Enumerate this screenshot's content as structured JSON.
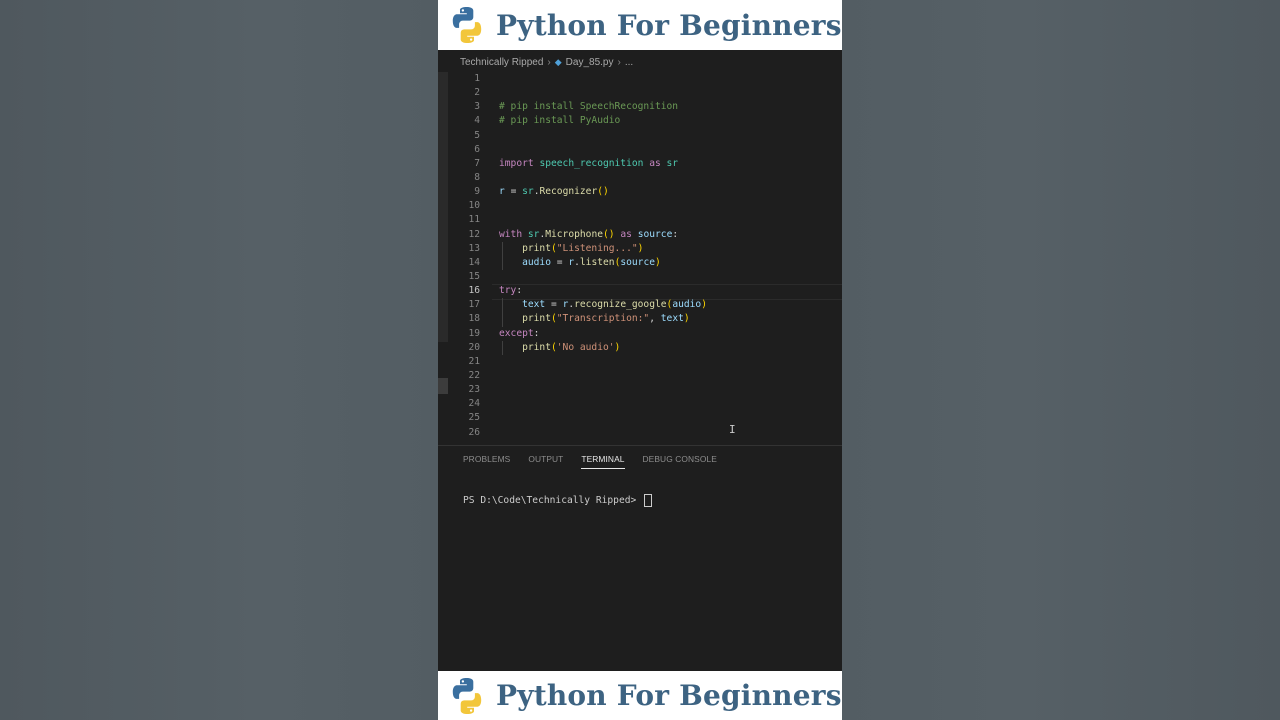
{
  "banner": {
    "title": "Python For Beginners"
  },
  "breadcrumb": {
    "folder": "Technically Ripped",
    "file": "Day_85.py",
    "more": "..."
  },
  "code_lines": [
    {
      "n": "1",
      "t": ""
    },
    {
      "n": "2",
      "t": ""
    },
    {
      "n": "3",
      "t": "# pip install SpeechRecognition"
    },
    {
      "n": "4",
      "t": "# pip install PyAudio"
    },
    {
      "n": "5",
      "t": ""
    },
    {
      "n": "6",
      "t": ""
    },
    {
      "n": "7",
      "t": "import speech_recognition as sr"
    },
    {
      "n": "8",
      "t": ""
    },
    {
      "n": "9",
      "t": "r = sr.Recognizer()"
    },
    {
      "n": "10",
      "t": ""
    },
    {
      "n": "11",
      "t": ""
    },
    {
      "n": "12",
      "t": "with sr.Microphone() as source:"
    },
    {
      "n": "13",
      "t": "    print(\"Listening...\")"
    },
    {
      "n": "14",
      "t": "    audio = r.listen(source)"
    },
    {
      "n": "15",
      "t": ""
    },
    {
      "n": "16",
      "t": "try:"
    },
    {
      "n": "17",
      "t": "    text = r.recognize_google(audio)"
    },
    {
      "n": "18",
      "t": "    print(\"Transcription:\", text)"
    },
    {
      "n": "19",
      "t": "except:"
    },
    {
      "n": "20",
      "t": "    print('No audio')"
    },
    {
      "n": "21",
      "t": ""
    },
    {
      "n": "22",
      "t": ""
    },
    {
      "n": "23",
      "t": ""
    },
    {
      "n": "24",
      "t": ""
    },
    {
      "n": "25",
      "t": ""
    },
    {
      "n": "26",
      "t": ""
    }
  ],
  "active_line": "16",
  "panel": {
    "tabs": [
      "PROBLEMS",
      "OUTPUT",
      "TERMINAL",
      "DEBUG CONSOLE"
    ],
    "active_tab": "TERMINAL",
    "prompt": "PS D:\\Code\\Technically Ripped> "
  },
  "colors": {
    "brand": "#3d6382",
    "editor_bg": "#1e1e1e"
  }
}
